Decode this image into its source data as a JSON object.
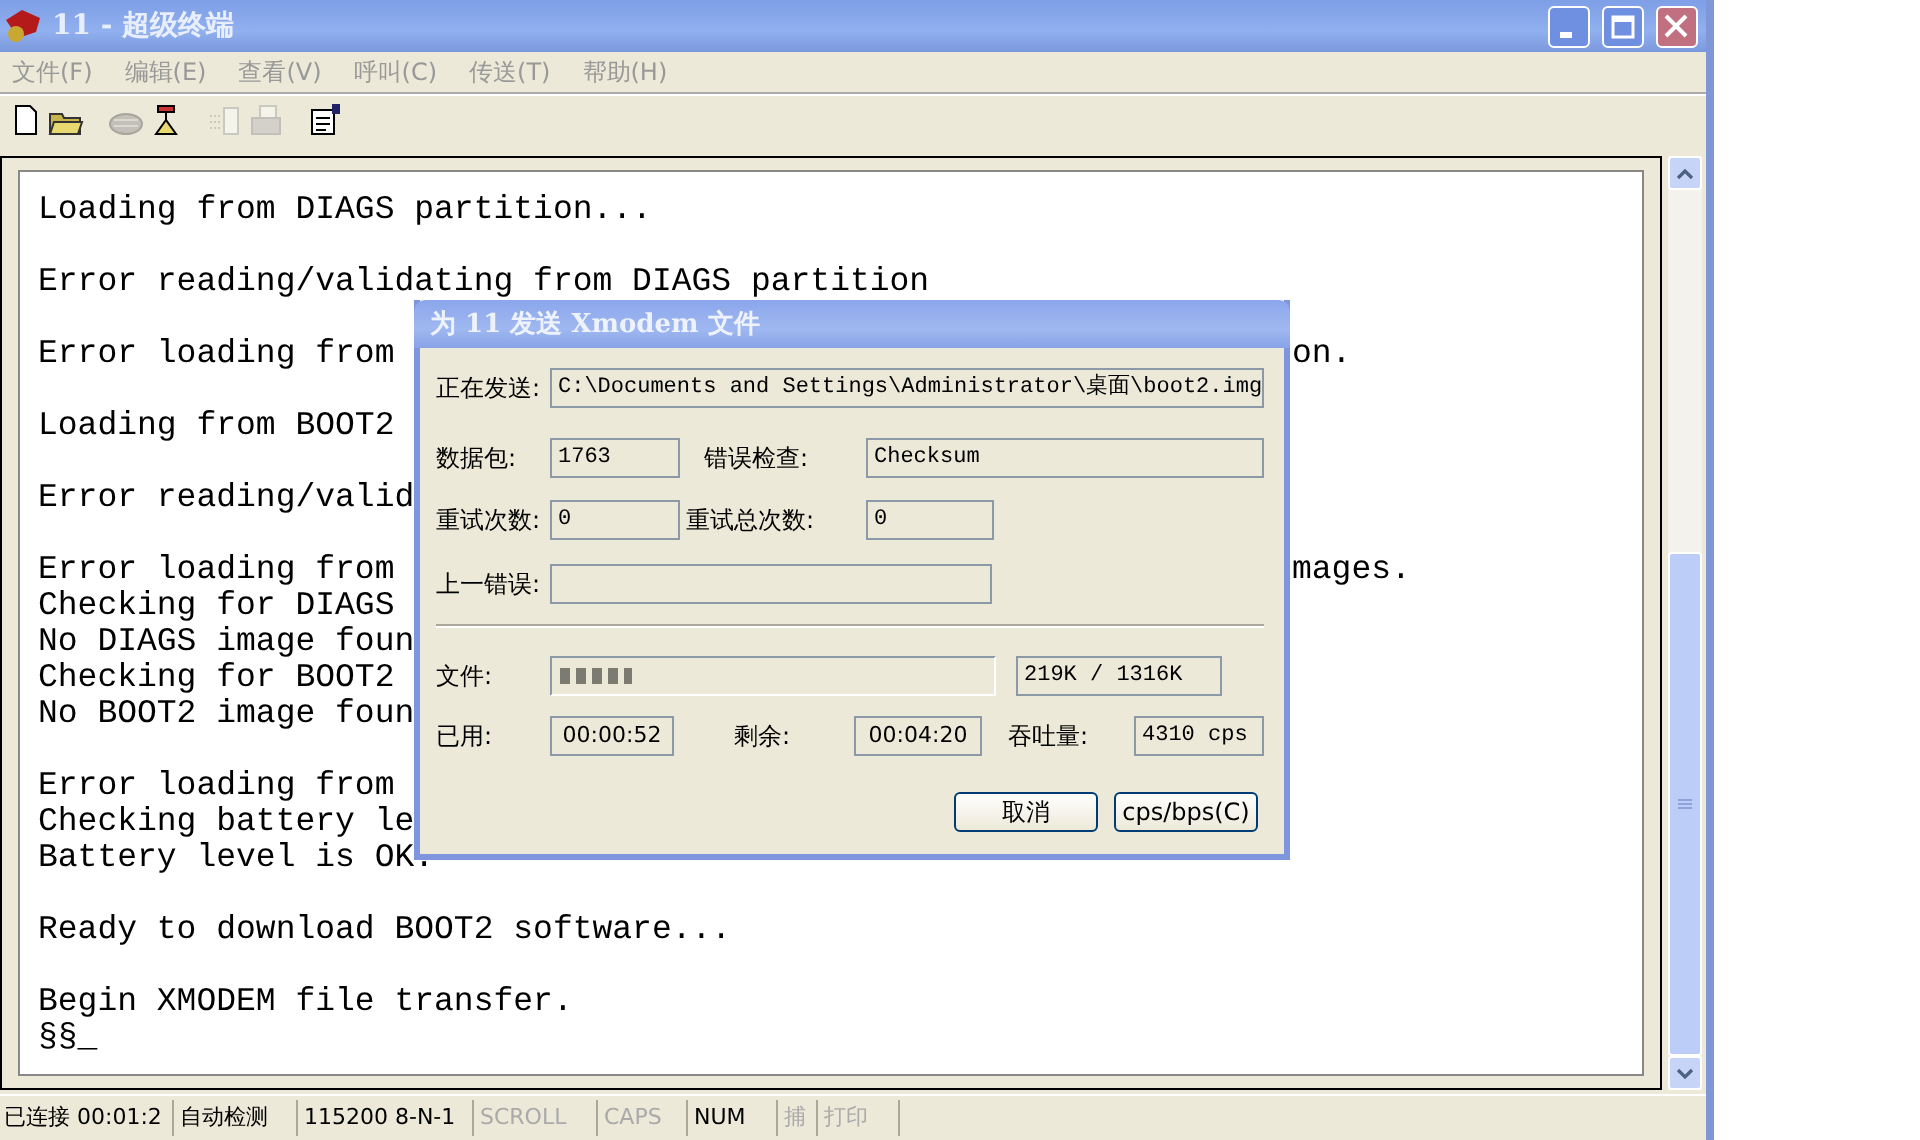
{
  "window": {
    "title": "11 - 超级终端",
    "active": false
  },
  "menu": [
    "文件(F)",
    "编辑(E)",
    "查看(V)",
    "呼叫(C)",
    "传送(T)",
    "帮助(H)"
  ],
  "toolbar": [
    {
      "kind": "new",
      "disabled": false
    },
    {
      "kind": "open",
      "disabled": false
    },
    {
      "kind": "call",
      "disabled": true
    },
    {
      "kind": "hangup",
      "disabled": false
    },
    {
      "kind": "send",
      "disabled": true
    },
    {
      "kind": "receive",
      "disabled": true
    },
    {
      "kind": "properties",
      "disabled": false
    }
  ],
  "terminal": {
    "paragraphs": [
      [
        {
          "text": "Loading from DIAGS partition..."
        }
      ],
      [
        {
          "text": "Error reading/validating from DIAGS partition"
        }
      ],
      [
        {
          "text": "Error loading from",
          "tail": "on."
        }
      ],
      [
        {
          "text": "Loading from BOOT2"
        }
      ],
      [
        {
          "text": "Error reading/valid"
        }
      ],
      [
        {
          "text": "Error loading from",
          "tail": "mages."
        },
        {
          "text": "Checking for DIAGS"
        },
        {
          "text": "No DIAGS image foun"
        },
        {
          "text": "Checking for BOOT2"
        },
        {
          "text": "No BOOT2 image foun"
        }
      ],
      [
        {
          "text": "Error loading from"
        },
        {
          "text": "Checking battery le"
        },
        {
          "text": "Battery level is OK."
        }
      ],
      [
        {
          "text": "Ready to download BOOT2 software..."
        }
      ],
      [
        {
          "text": "Begin XMODEM file transfer."
        },
        {
          "text": "§§_"
        }
      ]
    ]
  },
  "dialog": {
    "title": "为 11 发送 Xmodem 文件",
    "sending": {
      "label": "正在发送:",
      "value": "C:\\Documents and Settings\\Administrator\\桌面\\boot2.img"
    },
    "packet": {
      "label": "数据包:",
      "value": "1763"
    },
    "error_check": {
      "label": "错误检查:",
      "value": "Checksum"
    },
    "retries": {
      "label": "重试次数:",
      "value": "0"
    },
    "total_retries": {
      "label": "重试总次数:",
      "value": "0"
    },
    "last_error": {
      "label": "上一错误:"
    },
    "file": {
      "label": "文件:",
      "level": 0.17,
      "value": "219K / 1316K"
    },
    "elapsed": {
      "label": "已用:",
      "value": "00:00:52"
    },
    "remaining": {
      "label": "剩余:",
      "value": "00:04:20"
    },
    "throughput": {
      "label": "吞吐量:",
      "value": "4310 cps"
    },
    "buttons": [
      "取消",
      "cps/bps(C)"
    ]
  },
  "status_bar": [
    {
      "text": "已连接 00:01:2",
      "active": true
    },
    {
      "text": "自动检测",
      "active": true
    },
    {
      "text": "115200 8-N-1",
      "active": true
    },
    {
      "text": "SCROLL",
      "active": false
    },
    {
      "text": "CAPS",
      "active": false
    },
    {
      "text": "NUM",
      "active": true
    },
    {
      "text": "捕",
      "active": false
    },
    {
      "text": "打印",
      "active": false
    }
  ]
}
